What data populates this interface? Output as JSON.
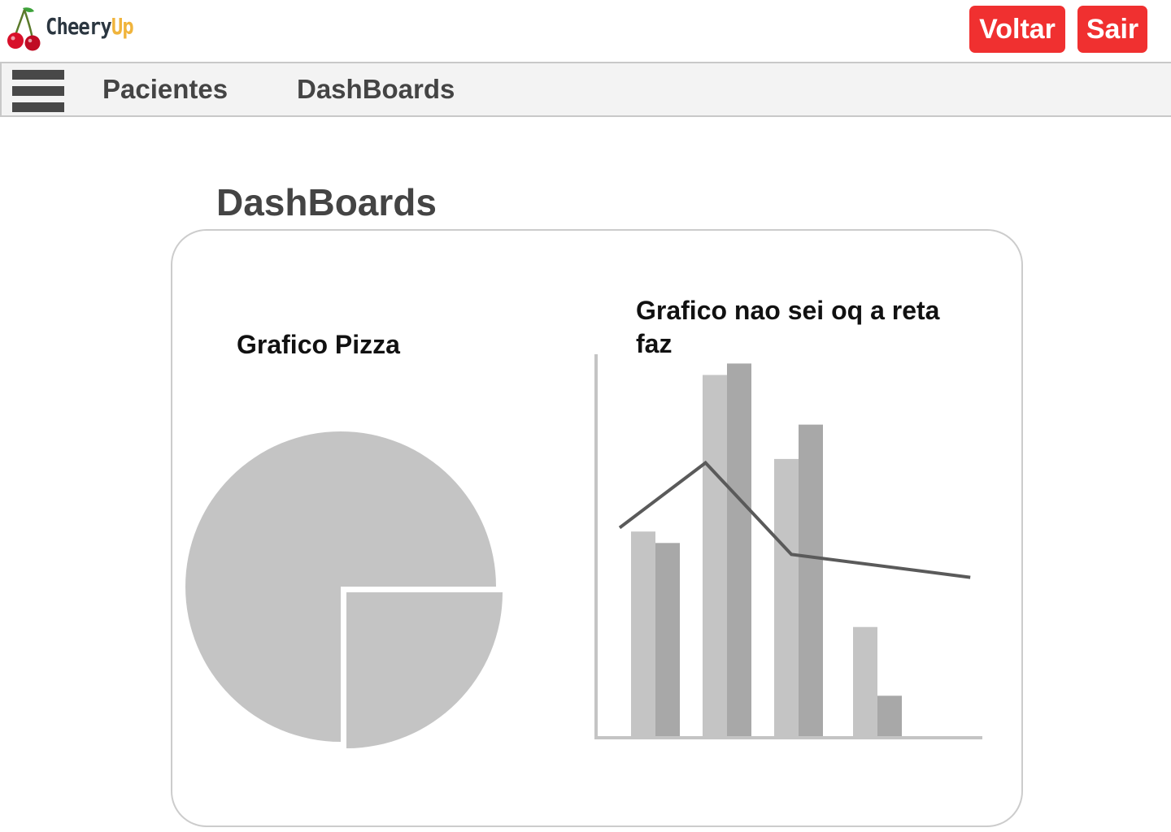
{
  "app": {
    "logo_word1": "Cheery",
    "logo_word2": "Up"
  },
  "header": {
    "back_label": "Voltar",
    "logout_label": "Sair"
  },
  "nav": {
    "items": [
      {
        "label": "Pacientes"
      },
      {
        "label": "DashBoards"
      }
    ]
  },
  "page": {
    "title": "DashBoards"
  },
  "colors": {
    "accent_red": "#f03030",
    "logo_dark": "#2b3640",
    "logo_yellow": "#f0b43c",
    "chart_light": "#c4c4c4",
    "chart_dark": "#a8a8a8",
    "line": "#5a5a5a"
  },
  "chart_data": [
    {
      "type": "pie",
      "title": "Grafico Pizza",
      "values": [
        75,
        25
      ]
    },
    {
      "type": "bar",
      "title": "Grafico nao sei oq a reta faz",
      "categories": [
        "",
        "",
        "",
        ""
      ],
      "series": [
        {
          "values": [
            54,
            95,
            73,
            29
          ]
        },
        {
          "values": [
            51,
            98,
            82,
            11
          ]
        }
      ],
      "line": {
        "x": [
          -0.5,
          0.7,
          1.9,
          4.4
        ],
        "values": [
          55,
          72,
          48,
          42
        ]
      },
      "ylim": [
        0,
        100
      ],
      "grid": false
    }
  ]
}
